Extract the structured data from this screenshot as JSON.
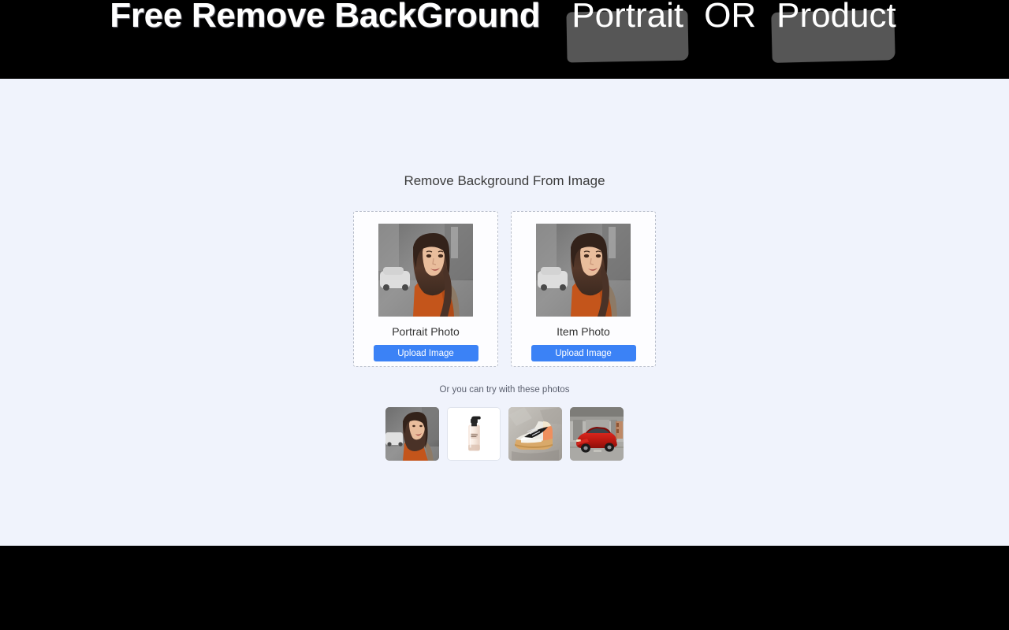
{
  "banner": {
    "title": "Free Remove BackGround",
    "word_portrait": "Portrait",
    "word_or": "OR",
    "word_product": "Product",
    "background_color": "#000000",
    "highlight_color": "#565656",
    "text_color": "#ffffff"
  },
  "main": {
    "background_color": "#f0f3fc",
    "heading": "Remove Background From Image",
    "samples_label": "Or you can try with these photos",
    "accent_color": "#3b82f6",
    "cards": [
      {
        "id": "portrait-photo",
        "label": "Portrait Photo",
        "button_label": "Upload Image",
        "thumb_name": "portrait-woman-orange-top"
      },
      {
        "id": "item-photo",
        "label": "Item Photo",
        "button_label": "Upload Image",
        "thumb_name": "portrait-woman-orange-top"
      }
    ],
    "samples": [
      {
        "id": "sample-portrait",
        "name": "portrait-woman-street",
        "selected": false
      },
      {
        "id": "sample-foundation",
        "name": "foundation-bottle-product",
        "selected": true
      },
      {
        "id": "sample-sneaker",
        "name": "nike-sneaker-orange",
        "selected": false
      },
      {
        "id": "sample-car",
        "name": "red-muscle-car-underpass",
        "selected": false
      }
    ]
  },
  "footer": {
    "background_color": "#000000"
  }
}
